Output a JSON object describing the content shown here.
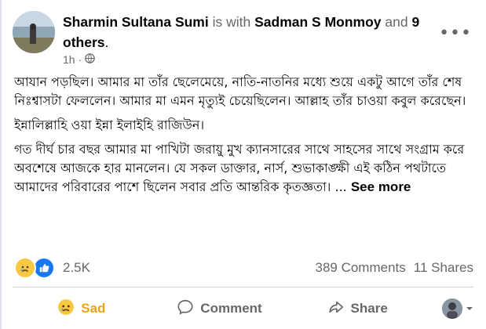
{
  "post": {
    "author": "Sharmin Sultana Sumi",
    "with_text": "is with",
    "tagged": "Sadman S Monmoy",
    "and_text": "and",
    "others": "9 others",
    "period": ".",
    "time": "1h",
    "more_glyph": "•••",
    "paragraphs": [
      "আযান পড়ছিল। আমার মা তাঁর ছেলেমেয়ে, নাতি-নাতনির  মধ্যে শুয়ে একটু আগে তাঁর শেষ নিঃশ্বাসটা ফেললেন। আমার মা এমন মৃত্যুই চেয়েছিলেন। আল্লাহ তাঁর চাওয়া কবুল করেছেন।",
      "ইন্নালিল্লাহি ওয়া ইন্না ইলাইহি রাজিউন।"
    ],
    "last_paragraph": "গত দীর্ঘ চার বছর আমার মা পাখিটা জরায়ু মুখ ক্যানসারের সাথে  সাহসের সাথে সংগ্রাম করে অবশেষে আজকে হার মানলেন। যে সকল ডাক্তার, নার্স, শুভাকাঙ্ক্ষী এই কঠিন পথটাতে আমাদের পরিবারের পাশে ছিলেন সবার প্রতি আন্তরিক কৃতজ্ঞতা। ...",
    "see_more": "See more"
  },
  "reactions": {
    "count": "2.5K",
    "comments": "389 Comments",
    "shares": "11 Shares"
  },
  "actions": {
    "sad": "Sad",
    "comment": "Comment",
    "share": "Share"
  },
  "colors": {
    "sad_accent": "#e9a414",
    "like_blue": "#1877f2",
    "secondary_text": "#65676b"
  },
  "icons": [
    "globe-icon",
    "more-icon",
    "sad-reaction-icon",
    "like-reaction-icon",
    "comment-icon",
    "share-icon",
    "chevron-down-icon"
  ]
}
